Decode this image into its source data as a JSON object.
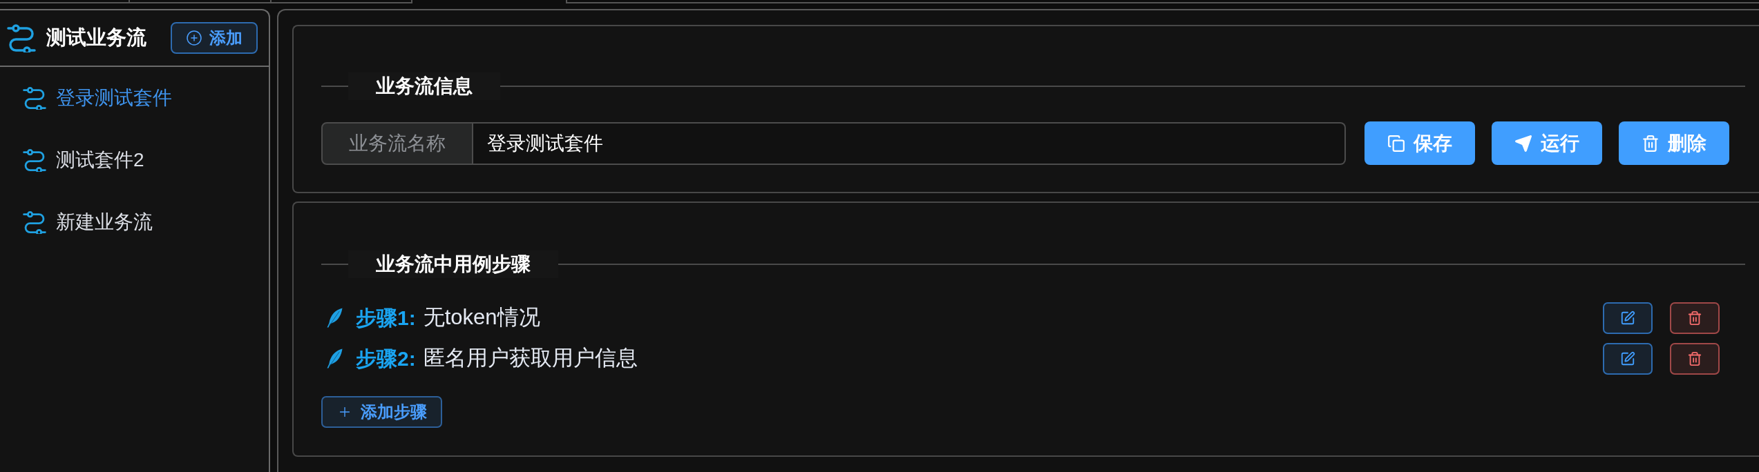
{
  "sidebar": {
    "title": "测试业务流",
    "add_button": "添加",
    "items": [
      {
        "label": "登录测试套件",
        "selected": true
      },
      {
        "label": "测试套件2",
        "selected": false
      },
      {
        "label": "新建业务流",
        "selected": false
      }
    ]
  },
  "info_section": {
    "title": "业务流信息",
    "name_field": {
      "label": "业务流名称",
      "value": "登录测试套件"
    },
    "buttons": [
      {
        "kind": "save",
        "label": "保存"
      },
      {
        "kind": "run",
        "label": "运行"
      },
      {
        "kind": "delete",
        "label": "删除"
      }
    ]
  },
  "steps_section": {
    "title": "业务流中用例步骤",
    "steps": [
      {
        "label": "步骤1:",
        "name": "无token情况"
      },
      {
        "label": "步骤2:",
        "name": "匿名用户获取用户信息"
      }
    ],
    "add_button": "添加步骤"
  }
}
